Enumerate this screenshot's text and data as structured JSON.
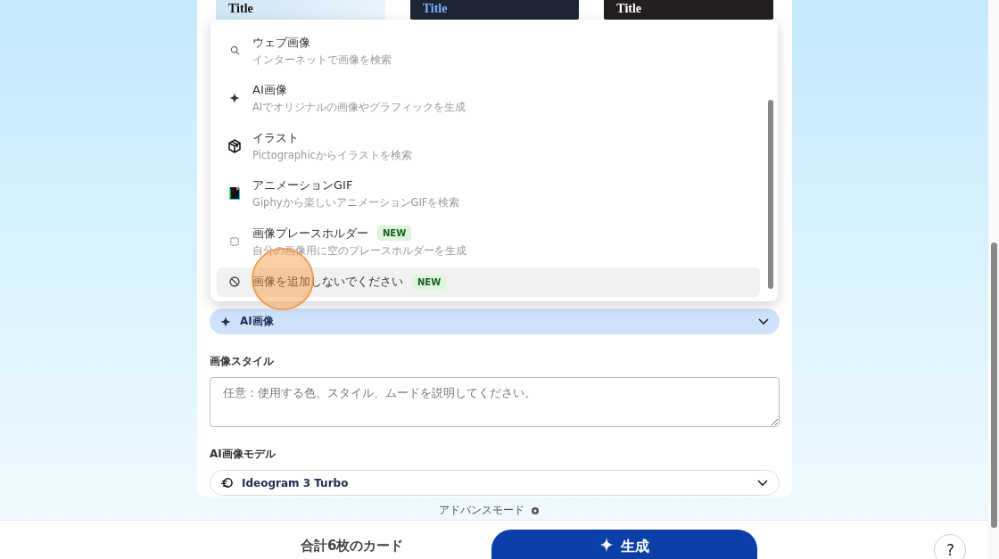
{
  "themes": [
    {
      "title": "Title",
      "kind": "light"
    },
    {
      "title": "Title",
      "kind": "navy"
    },
    {
      "title": "Title",
      "kind": "dark"
    }
  ],
  "image_source_menu": {
    "items": [
      {
        "kind": "search",
        "label": "ウェブ画像",
        "description": "インターネットで画像を検索",
        "selected": false
      },
      {
        "kind": "sparkle",
        "label": "AI画像",
        "description": "AIでオリジナルの画像やグラフィックを生成",
        "selected": false
      },
      {
        "kind": "cube",
        "label": "イラスト",
        "description": "Pictographicからイラストを検索",
        "selected": false
      },
      {
        "kind": "gif",
        "label": "アニメーションGIF",
        "description": "Giphyから楽しいアニメーションGIFを検索",
        "selected": false
      },
      {
        "kind": "placeholder",
        "label": "画像プレースホルダー",
        "badge": "NEW",
        "description": "自分の画像用に空のプレースホルダーを生成",
        "selected": false
      },
      {
        "kind": "none",
        "label": "画像を追加しないでください",
        "badge": "NEW",
        "selected": true
      }
    ]
  },
  "image_source": {
    "value": "AI画像"
  },
  "image_style": {
    "label": "画像スタイル",
    "placeholder": "任意：使用する色、スタイル、ムードを説明してください。"
  },
  "image_model": {
    "label": "AI画像モデル",
    "value": "Ideogram 3 Turbo"
  },
  "advanced_mode": "アドバンスモード",
  "footer": {
    "total": "合計6枚のカード",
    "generate": "生成",
    "help": "?"
  }
}
